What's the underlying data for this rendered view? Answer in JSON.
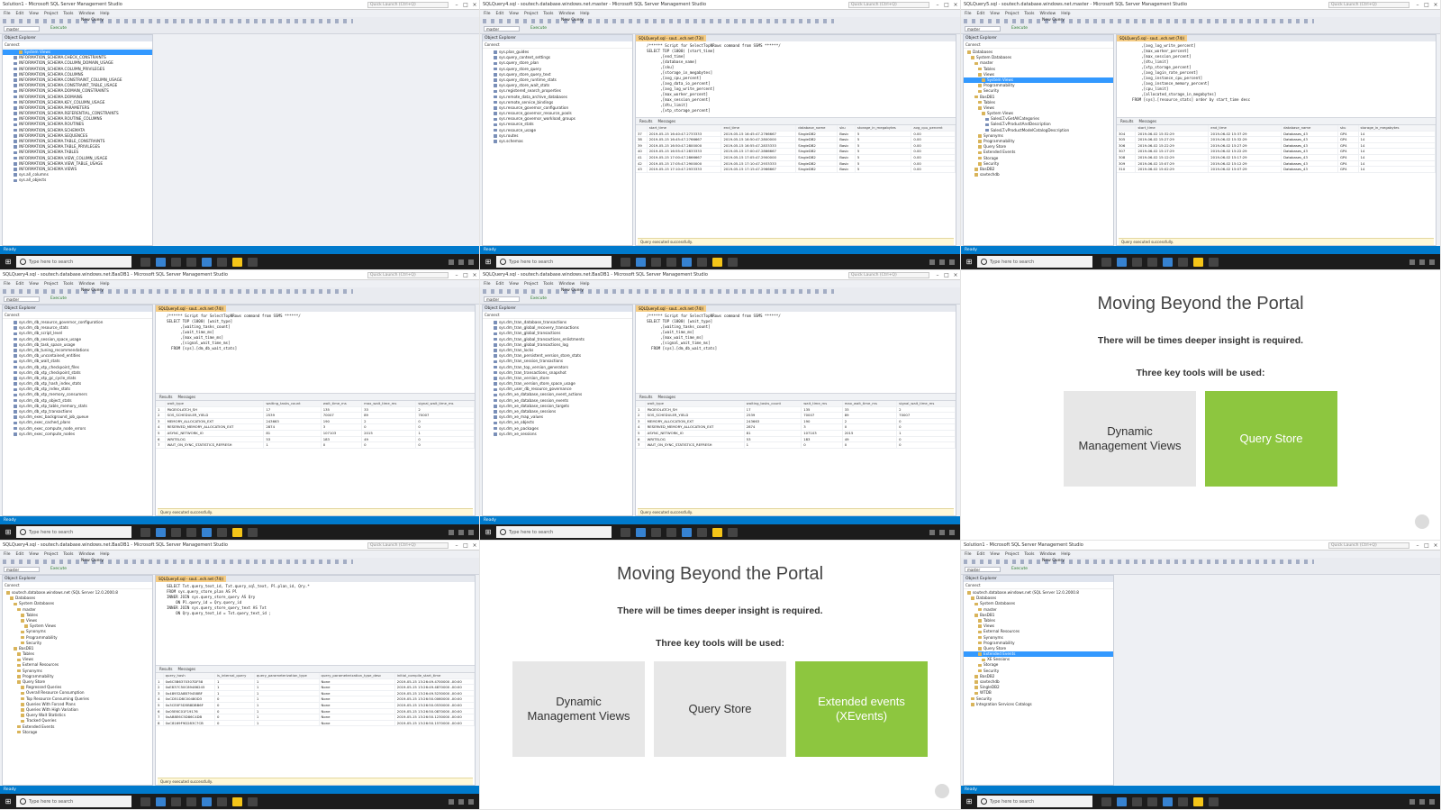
{
  "common": {
    "menu": [
      "File",
      "Edit",
      "View",
      "Project",
      "Tools",
      "Window",
      "Help"
    ],
    "quick_launch": "Quick Launch (Ctrl+Q)",
    "new_query": "New Query",
    "execute": "Execute",
    "object_explorer": "Object Explorer",
    "connect": "Connect",
    "results_tab": "Results",
    "messages_tab": "Messages",
    "exec_ok": "Query executed successfully.",
    "status_ready": "Ready",
    "taskbar_search": "Type here to search",
    "db_combo": "master"
  },
  "panel1": {
    "title": "Solution1 - Microsoft SQL Server Management Studio",
    "tree": [
      "System Views",
      "INFORMATION_SCHEMA.CHECK_CONSTRAINTS",
      "INFORMATION_SCHEMA.COLUMN_DOMAIN_USAGE",
      "INFORMATION_SCHEMA.COLUMN_PRIVILEGES",
      "INFORMATION_SCHEMA.COLUMNS",
      "INFORMATION_SCHEMA.CONSTRAINT_COLUMN_USAGE",
      "INFORMATION_SCHEMA.CONSTRAINT_TABLE_USAGE",
      "INFORMATION_SCHEMA.DOMAIN_CONSTRAINTS",
      "INFORMATION_SCHEMA.DOMAINS",
      "INFORMATION_SCHEMA.KEY_COLUMN_USAGE",
      "INFORMATION_SCHEMA.PARAMETERS",
      "INFORMATION_SCHEMA.REFERENTIAL_CONSTRAINTS",
      "INFORMATION_SCHEMA.ROUTINE_COLUMNS",
      "INFORMATION_SCHEMA.ROUTINES",
      "INFORMATION_SCHEMA.SCHEMATA",
      "INFORMATION_SCHEMA.SEQUENCES",
      "INFORMATION_SCHEMA.TABLE_CONSTRAINTS",
      "INFORMATION_SCHEMA.TABLE_PRIVILEGES",
      "INFORMATION_SCHEMA.TABLES",
      "INFORMATION_SCHEMA.VIEW_COLUMN_USAGE",
      "INFORMATION_SCHEMA.VIEW_TABLE_USAGE",
      "INFORMATION_SCHEMA.VIEWS",
      "sys.all_columns",
      "sys.all_objects"
    ]
  },
  "panel2": {
    "title": "SQLQuery4.sql - soutech.database.windows.net.master - Microsoft SQL Server Management Studio",
    "tab": "SQLQuery4.sql - sout...ech.net (73))",
    "tree": [
      "sys.plan_guides",
      "sys.query_context_settings",
      "sys.query_store_plan",
      "sys.query_store_query",
      "sys.query_store_query_text",
      "sys.query_store_runtime_stats",
      "sys.query_store_wait_stats",
      "sys.registered_search_properties",
      "sys.remote_data_archive_databases",
      "sys.remote_service_bindings",
      "sys.resource_governor_configuration",
      "sys.resource_governor_resource_pools",
      "sys.resource_governor_workload_groups",
      "sys.resource_stats",
      "sys.resource_usage",
      "sys.routes",
      "sys.schemas"
    ],
    "code": [
      "/****** Script for SelectTopNRows command from SSMS ******/",
      "SELECT TOP (1000) [start_time]",
      "      ,[end_time]",
      "      ,[database_name]",
      "      ,[sku]",
      "      ,[storage_in_megabytes]",
      "      ,[avg_cpu_percent]",
      "      ,[avg_data_io_percent]",
      "      ,[avg_log_write_percent]",
      "      ,[max_worker_percent]",
      "      ,[max_session_percent]",
      "      ,[dtu_limit]",
      "      ,[xtp_storage_percent]"
    ],
    "columns": [
      "",
      "start_time",
      "end_time",
      "database_name",
      "sku",
      "storage_in_megabytes",
      "avg_cpu_percent"
    ],
    "rows": [
      [
        "37",
        "2019-05-15 16:40:47.2733333",
        "2019-05-15 16:45:47.2766667",
        "SingleDB2",
        "Basic",
        "5",
        "0.00"
      ],
      [
        "38",
        "2019-05-15 16:45:47.2766667",
        "2019-05-15 16:50:47.2800000",
        "SingleDB2",
        "Basic",
        "5",
        "0.00"
      ],
      [
        "39",
        "2019-05-15 16:50:47.2800000",
        "2019-05-15 16:55:47.2833333",
        "SingleDB2",
        "Basic",
        "5",
        "0.00"
      ],
      [
        "40",
        "2019-05-15 16:55:47.2833333",
        "2019-05-15 17:00:47.2866667",
        "SingleDB2",
        "Basic",
        "5",
        "0.00"
      ],
      [
        "41",
        "2019-05-15 17:00:47.2866667",
        "2019-05-15 17:05:47.2900000",
        "SingleDB2",
        "Basic",
        "5",
        "0.00"
      ],
      [
        "42",
        "2019-05-15 17:05:47.2900000",
        "2019-05-15 17:10:47.2933333",
        "SingleDB2",
        "Basic",
        "5",
        "0.00"
      ],
      [
        "43",
        "2019-05-15 17:10:47.2933333",
        "2019-05-15 17:15:47.2966667",
        "SingleDB2",
        "Basic",
        "5",
        "0.00"
      ]
    ]
  },
  "panel3": {
    "title": "SQLQuery5.sql - soutech.database.windows.net.master - Microsoft SQL Server Management Studio",
    "tab": "SQLQuery5.sql - sout...ech.net (74))",
    "tree": [
      "Databases",
      "System Databases",
      "master",
      "Tables",
      "Views",
      "System Views",
      "Programmability",
      "Security",
      "BasDB1",
      "Tables",
      "Views",
      "System Views",
      "SalesLT.vGetAllCategories",
      "SalesLT.vProductAndDescription",
      "SalesLT.vProductModelCatalogDescription",
      "Synonyms",
      "Programmability",
      "Query Store",
      "Extended Events",
      "Storage",
      "Security",
      "BasDB2",
      "savtechdb"
    ],
    "code": [
      "      ,[avg_log_write_percent]",
      "      ,[max_worker_percent]",
      "      ,[max_session_percent]",
      "      ,[dtu_limit]",
      "      ,[xtp_storage_percent]",
      "      ,[avg_login_rate_percent]",
      "      ,[avg_instance_cpu_percent]",
      "      ,[avg_instance_memory_percent]",
      "      ,[cpu_limit]",
      "      ,[allocated_storage_in_megabytes]",
      "  FROM [sys].[resource_stats] order by start_time desc"
    ],
    "columns": [
      "",
      "start_time",
      "end_time",
      "database_name",
      "sku",
      "storage_in_megabytes"
    ],
    "rows": [
      [
        "304",
        "2019-06-02 15:32:29",
        "2019-06-02 15:37:29",
        "Databases_43",
        "GP4",
        "14"
      ],
      [
        "305",
        "2019-06-02 15:27:29",
        "2019-06-02 15:32:29",
        "Databases_43",
        "GP4",
        "14"
      ],
      [
        "306",
        "2019-06-02 15:22:29",
        "2019-06-02 15:27:29",
        "Databases_43",
        "GP4",
        "14"
      ],
      [
        "307",
        "2019-06-02 15:17:29",
        "2019-06-02 15:22:29",
        "Databases_43",
        "GP4",
        "14"
      ],
      [
        "308",
        "2019-06-02 15:12:29",
        "2019-06-02 15:17:29",
        "Databases_43",
        "GP4",
        "14"
      ],
      [
        "309",
        "2019-06-02 15:07:29",
        "2019-06-02 15:12:29",
        "Databases_43",
        "GP4",
        "14"
      ],
      [
        "310",
        "2019-06-02 15:02:29",
        "2019-06-02 15:07:29",
        "Databases_43",
        "GP4",
        "14"
      ]
    ]
  },
  "panel4": {
    "title": "SQLQuery4.sql - soutech.database.windows.net.BasDB1 - Microsoft SQL Server Management Studio",
    "tab": "SQLQuery4.sql - sout...ech.net (74))",
    "tree": [
      "sys.dm_db_resource_governor_configuration",
      "sys.dm_db_resource_stats",
      "sys.dm_db_script_level",
      "sys.dm_db_session_space_usage",
      "sys.dm_db_task_space_usage",
      "sys.dm_db_tuning_recommendations",
      "sys.dm_db_uncontained_entities",
      "sys.dm_db_wait_stats",
      "sys.dm_db_xtp_checkpoint_files",
      "sys.dm_db_xtp_checkpoint_stats",
      "sys.dm_db_xtp_gc_cycle_stats",
      "sys.dm_db_xtp_hash_index_stats",
      "sys.dm_db_xtp_index_stats",
      "sys.dm_db_xtp_memory_consumers",
      "sys.dm_db_xtp_object_stats",
      "sys.dm_db_xtp_table_memory_stats",
      "sys.dm_db_xtp_transactions",
      "sys.dm_exec_background_job_queue",
      "sys.dm_exec_cached_plans",
      "sys.dm_exec_compute_node_errors",
      "sys.dm_exec_compute_nodes"
    ],
    "code": [
      "/****** Script for SelectTopNRows command from SSMS ******/",
      "SELECT TOP (1000) [wait_type]",
      "      ,[waiting_tasks_count]",
      "      ,[wait_time_ms]",
      "      ,[max_wait_time_ms]",
      "      ,[signal_wait_time_ms]",
      "  FROM [sys].[dm_db_wait_stats]"
    ],
    "columns": [
      "",
      "wait_type",
      "waiting_tasks_count",
      "wait_time_ms",
      "max_wait_time_ms",
      "signal_wait_time_ms"
    ],
    "rows": [
      [
        "1",
        "PAGEIOLATCH_SH",
        "17",
        "135",
        "33",
        "2"
      ],
      [
        "2",
        "SOS_SCHEDULER_YIELD",
        "2539",
        "70007",
        "89",
        "70007"
      ],
      [
        "3",
        "MEMORY_ALLOCATION_EXT",
        "243663",
        "190",
        "2",
        "0"
      ],
      [
        "4",
        "RESERVED_MEMORY_ALLOCATION_EXT",
        "2874",
        "3",
        "0",
        "0"
      ],
      [
        "5",
        "ASYNC_NETWORK_IO",
        "81",
        "107103",
        "2015",
        "1"
      ],
      [
        "6",
        "WRITELOG",
        "53",
        "183",
        "49",
        "0"
      ],
      [
        "7",
        "WAIT_ON_SYNC_STATISTICS_REFRESH",
        "1",
        "0",
        "0",
        "0"
      ]
    ]
  },
  "panel5": {
    "title": "SQLQuery4.sql - soutech.database.windows.net.BasDB1 - Microsoft SQL Server Management Studio",
    "tab": "SQLQuery4.sql - sout...ech.net (74))",
    "tree": [
      "sys.dm_tran_database_transactions",
      "sys.dm_tran_global_recovery_transactions",
      "sys.dm_tran_global_transactions",
      "sys.dm_tran_global_transactions_enlistments",
      "sys.dm_tran_global_transactions_log",
      "sys.dm_tran_locks",
      "sys.dm_tran_persistent_version_store_stats",
      "sys.dm_tran_session_transactions",
      "sys.dm_tran_top_version_generators",
      "sys.dm_tran_transactions_snapshot",
      "sys.dm_tran_version_store",
      "sys.dm_tran_version_store_space_usage",
      "sys.dm_user_db_resource_governance",
      "sys.dm_xe_database_session_event_actions",
      "sys.dm_xe_database_session_events",
      "sys.dm_xe_database_session_targets",
      "sys.dm_xe_database_sessions",
      "sys.dm_xe_map_values",
      "sys.dm_xe_objects",
      "sys.dm_xe_packages",
      "sys.dm_xe_sessions"
    ],
    "code": [
      "/****** Script for SelectTopNRows command from SSMS ******/",
      "SELECT TOP (1000) [wait_type]",
      "      ,[waiting_tasks_count]",
      "      ,[wait_time_ms]",
      "      ,[max_wait_time_ms]",
      "      ,[signal_wait_time_ms]",
      "  FROM [sys].[dm_db_wait_stats]"
    ],
    "columns": [
      "",
      "wait_type",
      "waiting_tasks_count",
      "wait_time_ms",
      "max_wait_time_ms",
      "signal_wait_time_ms"
    ],
    "rows": [
      [
        "1",
        "PAGEIOLATCH_SH",
        "17",
        "135",
        "33",
        "2"
      ],
      [
        "2",
        "SOS_SCHEDULER_YIELD",
        "2539",
        "70007",
        "89",
        "70007"
      ],
      [
        "3",
        "MEMORY_ALLOCATION_EXT",
        "243663",
        "190",
        "2",
        "0"
      ],
      [
        "4",
        "RESERVED_MEMORY_ALLOCATION_EXT",
        "2874",
        "3",
        "0",
        "0"
      ],
      [
        "5",
        "ASYNC_NETWORK_IO",
        "81",
        "107103",
        "2015",
        "1"
      ],
      [
        "6",
        "WRITELOG",
        "53",
        "183",
        "49",
        "0"
      ],
      [
        "7",
        "WAIT_ON_SYNC_STATISTICS_REFRESH",
        "1",
        "0",
        "0",
        "0"
      ]
    ]
  },
  "panel6": {
    "title": "Moving Beyond the Portal",
    "line1": "There will be times deeper insight is required.",
    "line2": "Three key tools will be used:",
    "tiles": [
      "Dynamic Management Views",
      "Query Store"
    ]
  },
  "panel7": {
    "title": "SQLQuery4.sql - soutech.database.windows.net.BasDB1 - Microsoft SQL Server Management Studio",
    "tab": "SQLQuery4.sql - sout...ech.net (74))",
    "tree": [
      "soutech.database.windows.net (SQL Server 12.0.2000.8",
      "Databases",
      "System Databases",
      "master",
      "Tables",
      "Views",
      "System Views",
      "Synonyms",
      "Programmability",
      "Security",
      "BasDB1",
      "Tables",
      "Views",
      "External Resources",
      "Synonyms",
      "Programmability",
      "Query Store",
      "Regressed Queries",
      "Overall Resource Consumption",
      "Top Resource Consuming Queries",
      "Queries With Forced Plans",
      "Queries With High Variation",
      "Query Wait Statistics",
      "Tracked Queries",
      "Extended Events",
      "Storage"
    ],
    "code": [
      "SELECT Txt.query_text_id, Txt.query_sql_text, Pl.plan_id, Qry.*",
      "FROM sys.query_store_plan AS Pl",
      "INNER JOIN sys.query_store_query AS Qry",
      "    ON Pl.query_id = Qry.query_id",
      "INNER JOIN sys.query_store_query_text AS Txt",
      "    ON Qry.query_text_id = Txt.query_text_id ;"
    ],
    "columns": [
      "",
      "query_hash",
      "is_internal_query",
      "query_parameterization_type",
      "query_parameterization_type_desc",
      "initial_compile_start_time"
    ],
    "rows": [
      [
        "1",
        "0x6C5B6370307DF58",
        "1",
        "1",
        "None",
        "2019-05-15 13:26:49.4700000 -00:00"
      ],
      [
        "2",
        "0xE837C50C89486245",
        "1",
        "1",
        "None",
        "2019-05-15 13:26:49.4870000 -00:00"
      ],
      [
        "3",
        "0x48932A8B79458BF",
        "1",
        "1",
        "None",
        "2019-05-15 13:26:49.5230000 -00:00"
      ],
      [
        "4",
        "0xCD51D8C00480D3",
        "0",
        "1",
        "None",
        "2019-05-15 13:26:50.0060000 -00:00"
      ],
      [
        "5",
        "0x3CE0F5D5B8DBB6F",
        "0",
        "1",
        "None",
        "2019-05-15 13:26:50.0530000 -00:00"
      ],
      [
        "6",
        "0x05E6C01F19176",
        "0",
        "1",
        "None",
        "2019-05-15 13:26:50.0870000 -00:00"
      ],
      [
        "7",
        "0xAB8E6C5D86C4DB",
        "0",
        "1",
        "None",
        "2019-05-15 13:26:50.1230000 -00:00"
      ],
      [
        "8",
        "0xC8169F9D283C7CB",
        "0",
        "1",
        "None",
        "2019-05-15 13:26:50.1570000 -00:00"
      ]
    ]
  },
  "panel8": {
    "title": "Moving Beyond the Portal",
    "line1": "There will be times deeper insight is required.",
    "line2": "Three key tools will be used:",
    "tiles": [
      "Dynamic Management Views",
      "Query Store",
      "Extended events (XEvents)"
    ]
  },
  "panel9": {
    "title": "Solution1 - Microsoft SQL Server Management Studio",
    "tree": [
      "soutech.database.windows.net (SQL Server 12.0.2000.8",
      "Databases",
      "System Databases",
      "master",
      "BasDB1",
      "Tables",
      "Views",
      "External Resources",
      "Synonyms",
      "Programmability",
      "Query Store",
      "Extended Events",
      "XE Sessions",
      "Storage",
      "Security",
      "BasDB2",
      "savtechdb",
      "SingleDB2",
      "WTDB",
      "Security",
      "Integration Services Catalogs"
    ]
  },
  "colors": {
    "accent_green": "#8dc63f",
    "tile_grey": "#e7e7e7",
    "status_blue": "#007acc",
    "taskbar": "#1c1c1c"
  }
}
